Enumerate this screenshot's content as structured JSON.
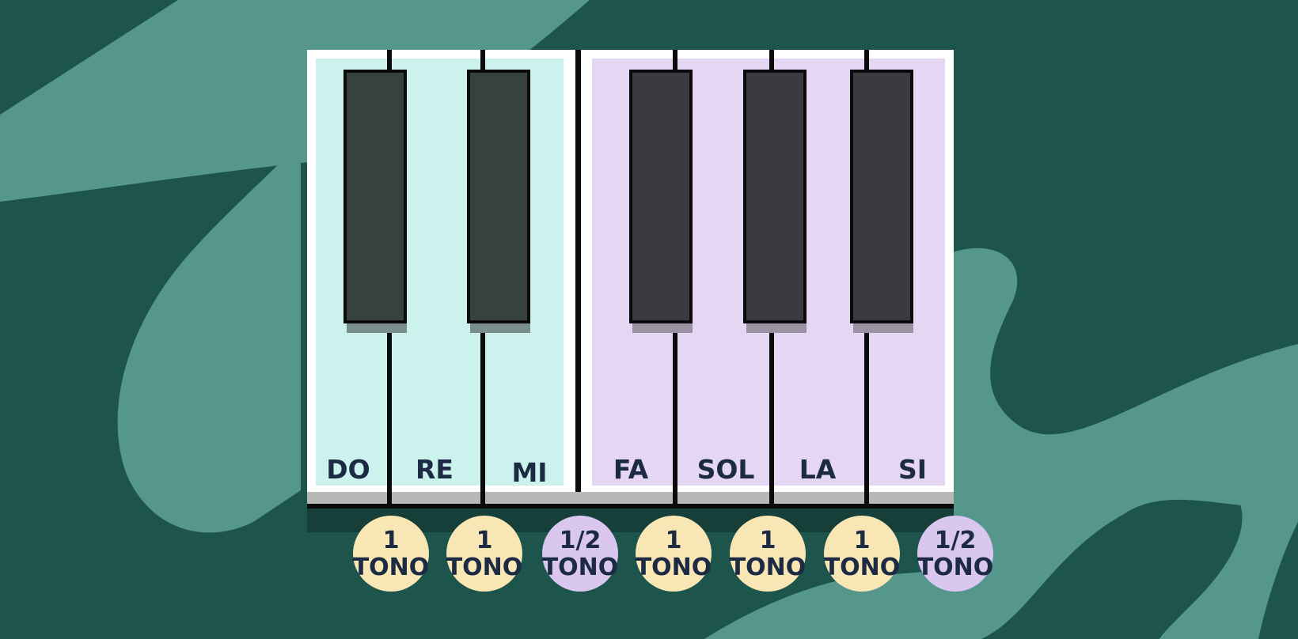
{
  "colors": {
    "background": "#1d554c",
    "background_swirl": "#55978b",
    "group1_fill": "#cbf2ec",
    "group2_fill": "#e5d6f4",
    "black_key_group1": "#36423f",
    "black_key_group2": "#3c3a41",
    "whole_tone_badge": "#f8e6b4",
    "half_tone_badge": "#d9c7f0",
    "label_text": "#1c2a44"
  },
  "notes": [
    "DO",
    "RE",
    "MI",
    "FA",
    "SOL",
    "LA",
    "SI"
  ],
  "intervals": [
    {
      "top": "1",
      "bottom": "TONO",
      "kind": "whole"
    },
    {
      "top": "1",
      "bottom": "TONO",
      "kind": "whole"
    },
    {
      "top": "1/2",
      "bottom": "TONO",
      "kind": "half"
    },
    {
      "top": "1",
      "bottom": "TONO",
      "kind": "whole"
    },
    {
      "top": "1",
      "bottom": "TONO",
      "kind": "whole"
    },
    {
      "top": "1",
      "bottom": "TONO",
      "kind": "whole"
    },
    {
      "top": "1/2",
      "bottom": "TONO",
      "kind": "half"
    }
  ]
}
